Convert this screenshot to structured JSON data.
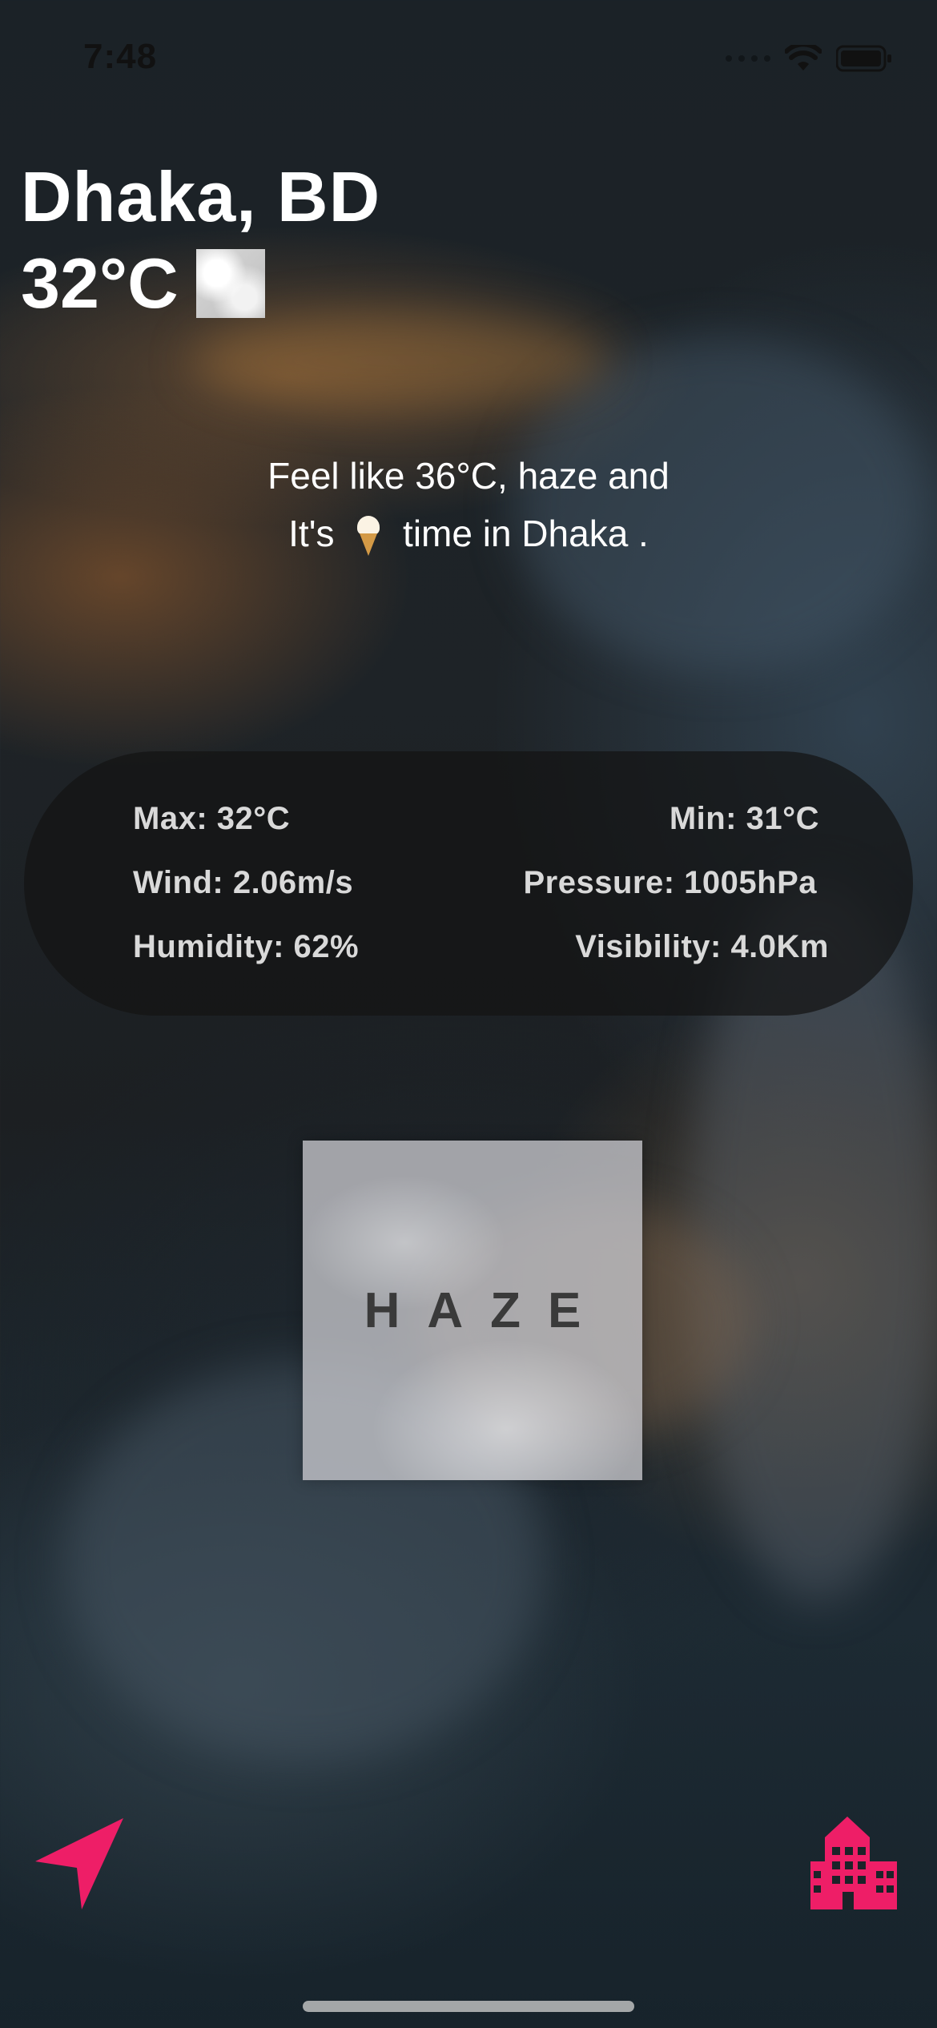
{
  "status_bar": {
    "time": "7:48",
    "icons": [
      "signal-dots",
      "wifi-icon",
      "battery-icon"
    ]
  },
  "location": {
    "city": "Dhaka, BD",
    "temperature": "32°C",
    "condition_icon": "cloud-thumbnail"
  },
  "summary": {
    "line1": "Feel like 36°C, haze and",
    "line2_prefix": "It's",
    "line2_suffix": "time in Dhaka .",
    "emoji": "ice-cream"
  },
  "stats": {
    "max": "Max: 32°C",
    "min": "Min: 31°C",
    "wind": "Wind: 2.06m/s",
    "pressure": "Pressure: 1005hPa",
    "humidity": "Humidity: 62%",
    "visibility": "Visibility: 4.0Km"
  },
  "condition_card": {
    "label": "HAZE"
  },
  "bottom_actions": {
    "left_icon": "location-arrow-icon",
    "right_icon": "city-buildings-icon",
    "accent_color": "#EE1E67"
  }
}
